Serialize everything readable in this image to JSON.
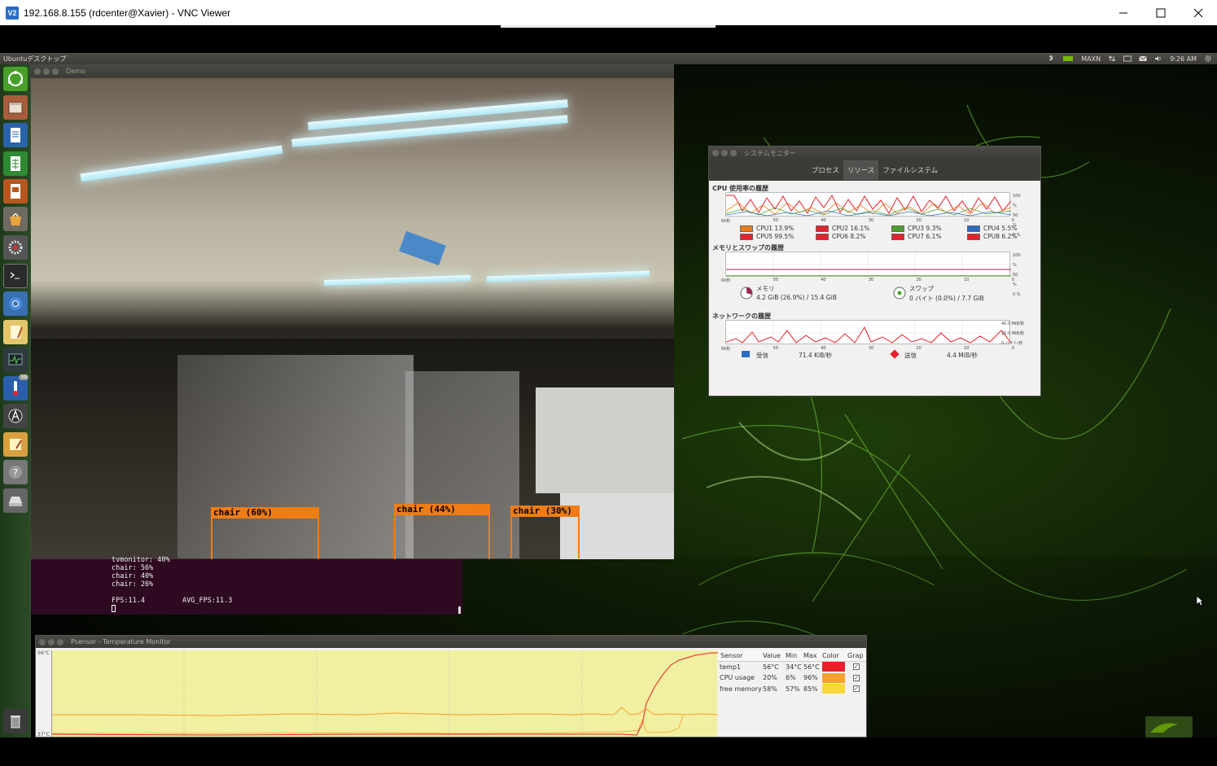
{
  "vnc": {
    "title": "192.168.8.155 (rdcenter@Xavier) - VNC Viewer",
    "logo_text": "V2",
    "controls": [
      "minimize-icon",
      "maximize-icon",
      "close-icon"
    ]
  },
  "topbar": {
    "title": "Ubuntuデスクトップ",
    "tray_power_mode": "MAXN",
    "clock": "9:26 AM",
    "tray_icons": [
      "bluetooth-icon",
      "nvidia-icon",
      "network-icon",
      "keyboard-icon",
      "mail-icon",
      "volume-icon",
      "gear-icon"
    ]
  },
  "launcher": {
    "items": [
      "ubuntu-home-icon",
      "files-icon",
      "writer-icon",
      "calc-icon",
      "impress-icon",
      "software-center-icon",
      "settings-icon",
      "terminal-icon",
      "chromium-icon",
      "text-editor-icon",
      "system-monitor-icon",
      "psensor-icon",
      "update-icon",
      "notes-icon",
      "help-icon",
      "drive-icon",
      "trash-icon"
    ],
    "badge": "59"
  },
  "demo": {
    "title": "Demo",
    "detections": [
      {
        "label": "chair (60%)"
      },
      {
        "label": "chair (44%)"
      },
      {
        "label": "chair (30%)"
      }
    ]
  },
  "terminal": {
    "lines": [
      "tvmonitor: 40%",
      "chair: 56%",
      "chair: 40%",
      "chair: 26%",
      "",
      "FPS:11.4         AVG_FPS:11.3"
    ]
  },
  "sysmon": {
    "title": "システムモニター",
    "tabs": [
      "プロセス",
      "リソース",
      "ファイルシステム"
    ],
    "active_tab": "リソース",
    "cpu_heading": "CPU 使用率の履歴",
    "mem_heading": "メモリとスワップの履歴",
    "net_heading": "ネットワークの履歴",
    "axis_x": [
      "60秒",
      "50",
      "40",
      "30",
      "20",
      "10",
      "0"
    ],
    "axis_y_pct": [
      "100 %",
      "50 %",
      "0 %"
    ],
    "axis_y_net": [
      "40.0 MiB/秒",
      "20.0 MiB/秒",
      "0 バイト/秒"
    ],
    "cpus": [
      {
        "name": "CPU1",
        "value": "13.9%",
        "color": "#f07c16"
      },
      {
        "name": "CPU2",
        "value": "16.1%",
        "color": "#e8202a"
      },
      {
        "name": "CPU3",
        "value": "9.3%",
        "color": "#4aa02c"
      },
      {
        "name": "CPU4",
        "value": "5.5%",
        "color": "#2a6cc4"
      },
      {
        "name": "CPU5",
        "value": "99.5%",
        "color": "#e8202a"
      },
      {
        "name": "CPU6",
        "value": "8.2%",
        "color": "#e8202a"
      },
      {
        "name": "CPU7",
        "value": "6.1%",
        "color": "#e8202a"
      },
      {
        "name": "CPU8",
        "value": "6.2%",
        "color": "#e8202a"
      }
    ],
    "memory": {
      "label": "メモリ",
      "value": "4.2 GiB (26.9%) / 15.4 GiB"
    },
    "swap": {
      "label": "スワップ",
      "value": "0 バイト (0.0%) / 7.7 GiB"
    },
    "net": {
      "recv_label": "受信",
      "recv_value": "71.4 KiB/秒",
      "send_label": "送信",
      "send_value": "4.4 MiB/秒"
    }
  },
  "psensor": {
    "title": "Psensor - Temperature Monitor",
    "y_top": "56°C",
    "y_bottom": "37°C",
    "columns": [
      "Sensor",
      "Value",
      "Min",
      "Max",
      "Color",
      "Grap"
    ],
    "rows": [
      {
        "sensor": "temp1",
        "value": "56°C",
        "min": "34°C",
        "max": "56°C",
        "color": "#e8202a"
      },
      {
        "sensor": "CPU usage",
        "value": "20%",
        "min": "6%",
        "max": "96%",
        "color": "#f6a030"
      },
      {
        "sensor": "free memory",
        "value": "58%",
        "min": "57%",
        "max": "85%",
        "color": "#f8d838"
      }
    ]
  }
}
